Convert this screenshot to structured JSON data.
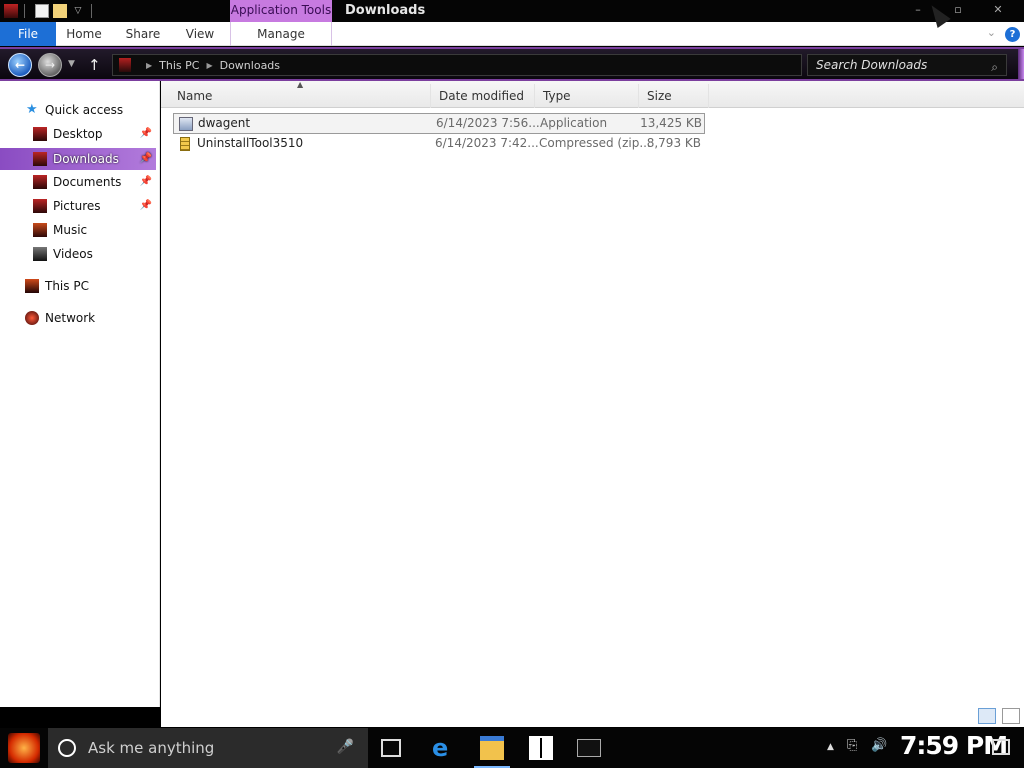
{
  "window": {
    "title": "Downloads",
    "context_tab": "Application Tools",
    "controls": {
      "minimize": "–",
      "maximize": "▫",
      "close": "✕"
    }
  },
  "ribbon": {
    "tabs": [
      "File",
      "Home",
      "Share",
      "View",
      "Manage"
    ],
    "help": "?"
  },
  "address": {
    "crumbs": [
      "This PC",
      "Downloads"
    ],
    "search_placeholder": "Search Downloads"
  },
  "nav": {
    "quick_access": "Quick access",
    "items": [
      {
        "label": "Desktop",
        "pinned": true,
        "icon": "desktop-icon"
      },
      {
        "label": "Downloads",
        "pinned": true,
        "icon": "downloads-icon"
      },
      {
        "label": "Documents",
        "pinned": true,
        "icon": "documents-icon"
      },
      {
        "label": "Pictures",
        "pinned": true,
        "icon": "pictures-icon"
      },
      {
        "label": "Music",
        "pinned": false,
        "icon": "music-icon"
      },
      {
        "label": "Videos",
        "pinned": false,
        "icon": "videos-icon"
      }
    ],
    "this_pc": "This PC",
    "network": "Network",
    "active": "Downloads"
  },
  "columns": [
    "Name",
    "Date modified",
    "Type",
    "Size"
  ],
  "files": [
    {
      "name": "dwagent",
      "date": "6/14/2023 7:56...",
      "type": "Application",
      "size": "13,425 KB",
      "icon": "application-icon",
      "selected": true
    },
    {
      "name": "UninstallTool3510",
      "date": "6/14/2023 7:42...",
      "type": "Compressed (zip...",
      "size": "8,793 KB",
      "icon": "zip-folder-icon",
      "selected": false
    }
  ],
  "taskbar": {
    "search_placeholder": "Ask me anything",
    "clock": "7:59 PM"
  },
  "colors": {
    "accent_purple": "#b27bdc",
    "file_tab_blue": "#1d6fd6",
    "context_tab": "#c77ae0"
  }
}
